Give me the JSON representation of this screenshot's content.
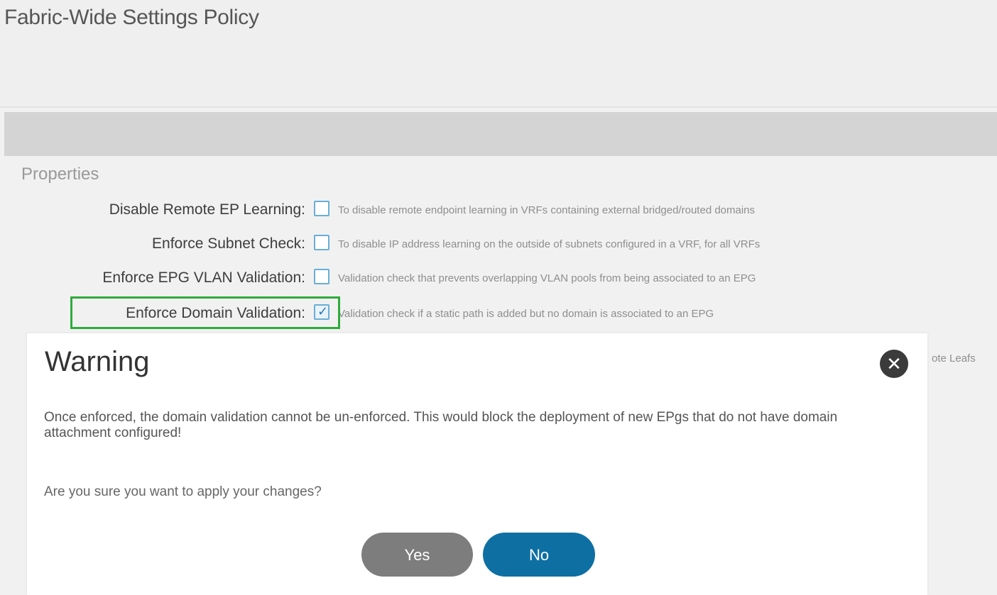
{
  "page": {
    "title": "Fabric-Wide Settings Policy"
  },
  "properties": {
    "heading": "Properties",
    "items": [
      {
        "label": "Disable Remote EP Learning:",
        "checked": false,
        "description": "To disable remote endpoint learning in VRFs containing external bridged/routed domains"
      },
      {
        "label": "Enforce Subnet Check:",
        "checked": false,
        "description": "To disable IP address learning on the outside of subnets configured in a VRF, for all VRFs"
      },
      {
        "label": "Enforce EPG VLAN Validation:",
        "checked": false,
        "description": "Validation check that prevents overlapping VLAN pools from being associated to an EPG"
      },
      {
        "label": "Enforce Domain Validation:",
        "checked": true,
        "description": "Validation check if a static path is added but no domain is associated to an EPG"
      }
    ],
    "partial_text": "ote Leafs"
  },
  "dialog": {
    "title": "Warning",
    "message": "Once enforced, the domain validation cannot be un-enforced. This would block the deployment of new EPgs that do not have domain attachment configured!",
    "question": "Are you sure you want to apply your changes?",
    "close_glyph": "✕",
    "yes_label": "Yes",
    "no_label": "No"
  },
  "colors": {
    "highlight": "#2eab3c",
    "checkbox_border": "#6aaed6",
    "yes_button": "#7d7d7d",
    "no_button": "#0e6fa3",
    "close_button": "#3b3b3b"
  }
}
